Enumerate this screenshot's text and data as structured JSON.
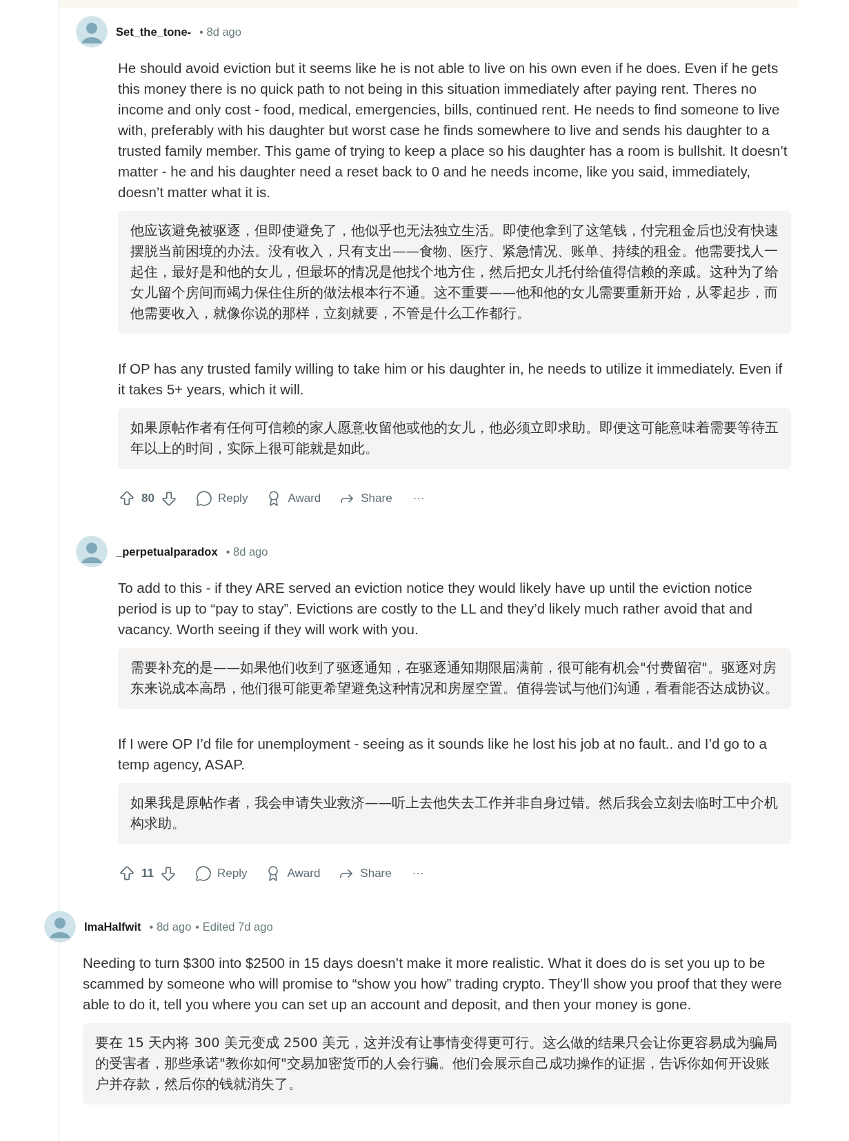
{
  "comments": [
    {
      "kind": "reply",
      "author": "Set_the_tone-",
      "time": "• 8d ago",
      "paragraphs": [
        {
          "text": "He should avoid eviction but it seems like he is not able to live on his own even if he does. Even if he gets this money there is no quick path to not being in this situation immediately after paying rent. Theres no income and only cost - food, medical, emergencies, bills, continued rent. He needs to find someone to live with, preferably with his daughter but worst case he finds somewhere to live and sends his daughter to a trusted family member. This game of trying to keep a place so his daughter has a room is bullshit. It doesn’t matter - he and his daughter need a reset back to 0 and he needs income, like you said, immediately, doesn’t matter what it is.",
          "translation": "他应该避免被驱逐，但即使避免了，他似乎也无法独立生活。即使他拿到了这笔钱，付完租金后也没有快速摆脱当前困境的办法。没有收入，只有支出——食物、医疗、紧急情况、账单、持续的租金。他需要找人一起住，最好是和他的女儿，但最坏的情况是他找个地方住，然后把女儿托付给值得信赖的亲戚。这种为了给女儿留个房间而竭力保住住所的做法根本行不通。这不重要——他和他的女儿需要重新开始，从零起步，而他需要收入，就像你说的那样，立刻就要，不管是什么工作都行。"
        },
        {
          "text": "If OP has any trusted family willing to take him or his daughter in, he needs to utilize it immediately. Even if it takes 5+ years, which it will.",
          "translation": "如果原帖作者有任何可信赖的家人愿意收留他或他的女儿，他必须立即求助。即便这可能意味着需要等待五年以上的时间，实际上很可能就是如此。"
        }
      ],
      "actions": {
        "votes": "80",
        "buttons": [
          "Reply",
          "Award",
          "Share"
        ],
        "more": "···"
      }
    },
    {
      "kind": "reply",
      "author": "_perpetualparadox",
      "time": "• 8d ago",
      "paragraphs": [
        {
          "text": "To add to this - if they ARE served an eviction notice they would likely have up until the eviction notice period is up to “pay to stay”. Evictions are costly to the LL and they’d likely much rather avoid that and vacancy. Worth seeing if they will work with you.",
          "translation": "需要补充的是——如果他们收到了驱逐通知，在驱逐通知期限届满前，很可能有机会\"付费留宿\"。驱逐对房东来说成本高昂，他们很可能更希望避免这种情况和房屋空置。值得尝试与他们沟通，看看能否达成协议。"
        },
        {
          "text": "If I were OP I’d file for unemployment - seeing as it sounds like he lost his job at no fault.. and I’d go to a temp agency, ASAP.",
          "translation": "如果我是原帖作者，我会申请失业救济——听上去他失去工作并非自身过错。然后我会立刻去临时工中介机构求助。"
        }
      ],
      "actions": {
        "votes": "11",
        "buttons": [
          "Reply",
          "Award",
          "Share"
        ],
        "more": "···"
      }
    },
    {
      "kind": "top",
      "author": "ImaHalfwit",
      "time": "• 8d ago",
      "edited": "• Edited 7d ago",
      "paragraphs": [
        {
          "text": "Needing to turn $300 into $2500 in 15 days doesn’t make it more realistic. What it does do is set you up to be scammed by someone who will promise to “show you how” trading crypto. They’ll show you proof that they were able to do it, tell you where you can set up an account and deposit, and then your money is gone.",
          "translation": "要在 15 天内将 300 美元变成 2500 美元，这并没有让事情变得更可行。这么做的结果只会让你更容易成为骗局的受害者，那些承诺\"教你如何\"交易加密货币的人会行骗。他们会展示自己成功操作的证据，告诉你如何开设账户并存款，然后你的钱就消失了。"
        }
      ]
    }
  ]
}
